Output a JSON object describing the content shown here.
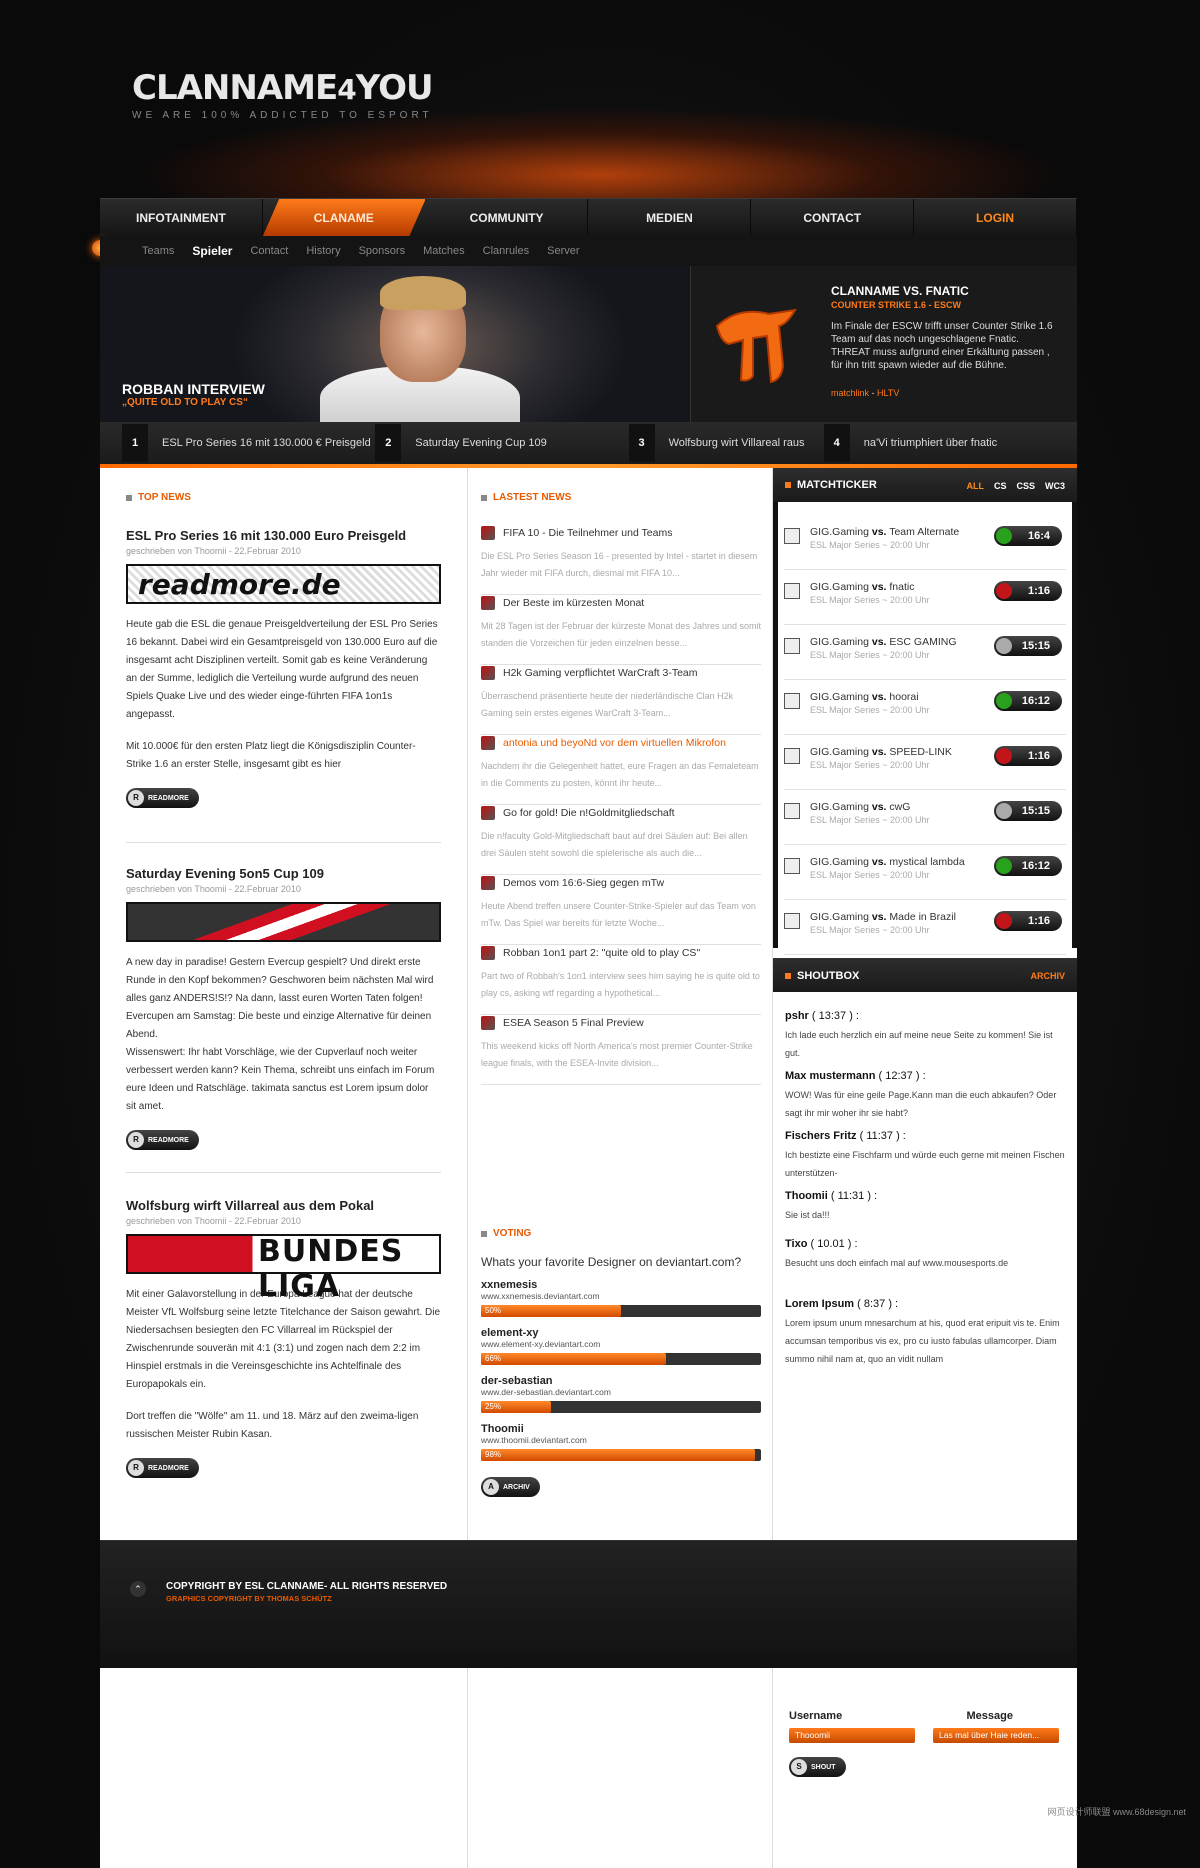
{
  "brand": {
    "name": "CLANNAME",
    "num": "4",
    "you": "YOU",
    "slogan": "WE ARE 100% ADDICTED TO ESPORT"
  },
  "nav": [
    {
      "label": "INFOTAINMENT"
    },
    {
      "label": "CLANAME",
      "active": true
    },
    {
      "label": "COMMUNITY"
    },
    {
      "label": "MEDIEN"
    },
    {
      "label": "CONTACT"
    },
    {
      "label": "LOGIN"
    }
  ],
  "subnav": [
    "Teams",
    "Spieler",
    "Contact",
    "History",
    "Sponsors",
    "Matches",
    "Clanrules",
    "Server"
  ],
  "hero": {
    "title": "ROBBAN INTERVIEW",
    "subtitle": "„QUITE OLD TO PLAY CS“",
    "side": {
      "title": "CLANNAME VS. FNATIC",
      "sub": "COUNTER STRIKE 1.6 - ESCW",
      "text": "Im Finale der ESCW trifft unser Counter Strike 1.6 Team auf das noch ungeschlagene Fnatic. THREAT muss aufgrund einer Erkältung passen , für ihn tritt spawn wieder auf die Bühne.",
      "link1": "matchlink",
      "sep": "-",
      "link2": "HLTV"
    }
  },
  "ticker": [
    {
      "n": "1",
      "t": "ESL Pro Series 16 mit 130.000 € Preisgeld"
    },
    {
      "n": "2",
      "t": "Saturday Evening Cup 109"
    },
    {
      "n": "3",
      "t": "Wolfsburg wirt Villareal raus"
    },
    {
      "n": "4",
      "t": "na'Vi triumphiert über fnatic"
    }
  ],
  "topnews": {
    "label": "TOP NEWS",
    "articles": [
      {
        "title": "ESL Pro Series 16 mit 130.000 Euro Preisgeld",
        "meta": "geschrieben von Thoomii - 22.Februar 2010",
        "banner": "readmore.de",
        "text": "Heute gab die ESL die genaue Preisgeldverteilung der ESL Pro Series 16 bekannt. Dabei wird ein Gesamtpreisgeld von 130.000 Euro auf die insgesamt acht Disziplinen verteilt. Somit gab es keine Veränderung an der Summe, lediglich die Verteilung wurde aufgrund des neuen Spiels Quake Live und des wieder einge-führten FIFA 1on1s angepasst.",
        "text2": "Mit 10.000€ für den ersten Platz liegt die Königsdisziplin Counter-Strike 1.6 an erster Stelle, insgesamt gibt es hier",
        "more": "READMORE",
        "moreicon": "R"
      },
      {
        "title": "Saturday Evening 5on5 Cup 109",
        "meta": "geschrieben von Thoomii - 22.Februar 2010",
        "banner": "",
        "text": "A new day in paradise! Gestern Evercup gespielt? Und direkt erste Runde in den Kopf bekommen? Geschworen beim nächsten Mal wird alles ganz ANDERS!S!? Na dann, lasst euren Worten Taten folgen! Evercupen am Samstag: Die beste und einzige Alternative für deinen Abend.",
        "text2": "Wissenswert: Ihr habt Vorschläge, wie der Cupverlauf noch weiter verbessert werden kann? Kein Thema, schreibt uns einfach im Forum eure Ideen und Ratschläge. takimata sanctus est Lorem ipsum dolor sit amet.",
        "more": "READMORE",
        "moreicon": "R"
      },
      {
        "title": "Wolfsburg wirft Villarreal aus dem Pokal",
        "meta": "geschrieben von Thoomii - 22.Februar 2010",
        "banner": "BUNDES LIGA",
        "text": "Mit einer Galavorstellung in der Europa League hat der deutsche Meister VfL Wolfsburg seine letzte Titelchance der Saison gewahrt. Die Niedersachsen besiegten den FC Villarreal im Rückspiel der Zwischenrunde souverän mit 4:1 (3:1) und zogen nach dem 2:2 im Hinspiel erstmals in die Vereinsgeschichte ins Achtelfinale des Europapokals ein.",
        "text2": "Dort treffen die \"Wölfe\" am 11. und 18. März auf den zweima-ligen russischen Meister Rubin Kasan.",
        "more": "READMORE",
        "moreicon": "R"
      }
    ]
  },
  "latest": {
    "label": "LASTEST NEWS",
    "items": [
      {
        "t": "FIFA 10 - Die Teilnehmer und Teams",
        "e": "Die ESL Pro Series Season 16 - presented by Intel - startet in diesem Jahr wieder mit FIFA durch, diesmal mit FIFA 10..."
      },
      {
        "t": "Der Beste im kürzesten Monat",
        "e": "Mit 28 Tagen ist der Februar der kürzeste Monat des Jahres und somit standen die Vorzeichen für jeden einzelnen besse..."
      },
      {
        "t": "H2k Gaming verpflichtet WarCraft 3-Team",
        "e": "Überraschend präsentierte heute der niederländische Clan H2k Gaming sein erstes eigenes WarCraft 3-Team..."
      },
      {
        "t": "antonia und beyoNd vor dem virtuellen Mikrofon",
        "e": "Nachdem ihr die Gelegenheit hattet, eure Fragen an das Femaleteam in die Comments zu posten, könnt ihr heute...",
        "hl": true
      },
      {
        "t": "Go for gold! Die n!Goldmitgliedschaft",
        "e": "Die n!faculty Gold-Mitgliedschaft baut auf drei Säulen auf: Bei allen drei Säulen steht sowohl die spielerische als auch die..."
      },
      {
        "t": "Demos vom 16:6-Sieg gegen mTw",
        "e": "Heute Abend treffen unsere Counter-Strike-Spieler auf das Team von mTw. Das Spiel war bereits für letzte Woche..."
      },
      {
        "t": "Robban 1on1 part 2: \"quite old to play CS\"",
        "e": "Part two of Robbah's 1on1 interview sees him saying he is quite old to play cs, asking wtf regarding a hypothetical..."
      },
      {
        "t": "ESEA Season 5 Final Preview",
        "e": "This weekend kicks off North America's most premier Counter-Strike league finals, with the ESEA-Invite division..."
      }
    ]
  },
  "voting": {
    "label": "VOTING",
    "question": "Whats your favorite Designer on deviantart.com?",
    "options": [
      {
        "n": "xxnemesis",
        "u": "www.xxnemesis.deviantart.com",
        "p": "50%",
        "v": 0.5
      },
      {
        "n": "element-xy",
        "u": "www.element-xy.deviantart.com",
        "p": "66%",
        "v": 0.66
      },
      {
        "n": "der-sebastian",
        "u": "www.der-sebastian.deviantart.com",
        "p": "25%",
        "v": 0.25
      },
      {
        "n": "Thoomii",
        "u": "www.thoomii.deviantart.com",
        "p": "98%",
        "v": 0.98
      }
    ],
    "archiv": "ARCHIV",
    "archivicon": "A"
  },
  "matchticker": {
    "label": "MATCHTICKER",
    "tabs": [
      "ALL",
      "CS",
      "CSS",
      "WC3"
    ],
    "vs": "vs.",
    "matches": [
      {
        "a": "GIG.Gaming",
        "b": "Team Alternate",
        "l": "ESL Major Series ~ 20:00 Uhr",
        "s": "16:4",
        "r": "win"
      },
      {
        "a": "GIG.Gaming",
        "b": "fnatic",
        "l": "ESL Major Series ~ 20:00 Uhr",
        "s": "1:16",
        "r": "los"
      },
      {
        "a": "GIG.Gaming",
        "b": "ESC GAMING",
        "l": "ESL Major Series ~ 20:00 Uhr",
        "s": "15:15",
        "r": "drw"
      },
      {
        "a": "GIG.Gaming",
        "b": "hoorai",
        "l": "ESL Major Series ~ 20:00 Uhr",
        "s": "16:12",
        "r": "win"
      },
      {
        "a": "GIG.Gaming",
        "b": "SPEED-LINK",
        "l": "ESL Major Series ~ 20:00 Uhr",
        "s": "1:16",
        "r": "los"
      },
      {
        "a": "GIG.Gaming",
        "b": "cwG",
        "l": "ESL Major Series ~ 20:00 Uhr",
        "s": "15:15",
        "r": "drw"
      },
      {
        "a": "GIG.Gaming",
        "b": "mystical lambda",
        "l": "ESL Major Series ~ 20:00 Uhr",
        "s": "16:12",
        "r": "win"
      },
      {
        "a": "GIG.Gaming",
        "b": "Made in Brazil",
        "l": "ESL Major Series ~ 20:00 Uhr",
        "s": "1:16",
        "r": "los"
      }
    ]
  },
  "shoutbox": {
    "label": "SHOUTBOX",
    "archiv": "ARCHIV",
    "messages": [
      {
        "u": "pshr",
        "tm": "( 13:37 ) :",
        "t": "Ich lade euch herzlich ein auf meine neue Seite zu kommen! Sie ist gut."
      },
      {
        "u": "Max mustermann",
        "tm": "( 12:37 ) :",
        "t": "WOW! Was für eine geile Page.Kann man die euch abkaufen? Oder sagt ihr mir woher ihr sie habt?"
      },
      {
        "u": "Fischers Fritz",
        "tm": "( 11:37 ) :",
        "t": "Ich bestizte eine Fischfarm und würde euch gerne mit meinen Fischen unterstützen-"
      },
      {
        "u": "Thoomii",
        "tm": "( 11:31 ) :",
        "t": "Sie ist da!!!"
      },
      {
        "u": "Tixo",
        "tm": "( 10.01 ) :",
        "t": "Besucht uns doch einfach mal auf www.mousesports.de"
      },
      {
        "u": "Lorem Ipsum",
        "tm": "( 8:37 ) :",
        "t": "Lorem ipsum unum mnesarchum at his, quod erat eripuit vis te. Enim accumsan temporibus vis ex, pro cu iusto fabulas ullamcorper. Diam summo nihil nam at, quo an vidit nullam"
      }
    ],
    "username_label": "Username",
    "message_label": "Message",
    "username_val": "Thooomii",
    "message_val": "Las mal über Haie reden...",
    "shout": "SHOUT",
    "shouticon": "S"
  },
  "footer": {
    "c1": "COPYRIGHT BY ESL CLANNAME- ALL RIGHTS RESERVED",
    "c2": "GRAPHICS COPYRIGHT BY THOMAS SCHÜTZ",
    "up": "⌃"
  },
  "watermark": "网页设计师联盟 www.68design.net"
}
